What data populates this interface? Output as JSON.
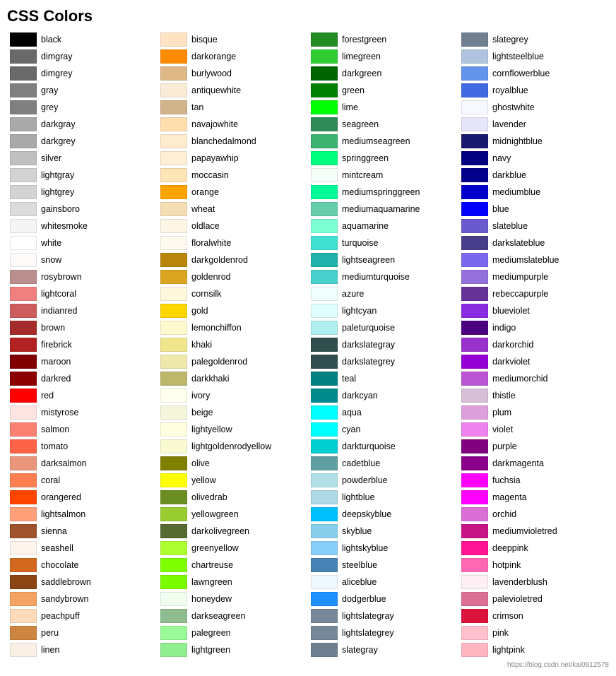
{
  "title": "CSS Colors",
  "colors": [
    {
      "name": "black",
      "hex": "#000000"
    },
    {
      "name": "dimgray",
      "hex": "#696969"
    },
    {
      "name": "dimgrey",
      "hex": "#696969"
    },
    {
      "name": "gray",
      "hex": "#808080"
    },
    {
      "name": "grey",
      "hex": "#808080"
    },
    {
      "name": "darkgray",
      "hex": "#a9a9a9"
    },
    {
      "name": "darkgrey",
      "hex": "#a9a9a9"
    },
    {
      "name": "silver",
      "hex": "#c0c0c0"
    },
    {
      "name": "lightgray",
      "hex": "#d3d3d3"
    },
    {
      "name": "lightgrey",
      "hex": "#d3d3d3"
    },
    {
      "name": "gainsboro",
      "hex": "#dcdcdc"
    },
    {
      "name": "whitesmoke",
      "hex": "#f5f5f5"
    },
    {
      "name": "white",
      "hex": "#ffffff"
    },
    {
      "name": "snow",
      "hex": "#fffafa"
    },
    {
      "name": "rosybrown",
      "hex": "#bc8f8f"
    },
    {
      "name": "lightcoral",
      "hex": "#f08080"
    },
    {
      "name": "indianred",
      "hex": "#cd5c5c"
    },
    {
      "name": "brown",
      "hex": "#a52a2a"
    },
    {
      "name": "firebrick",
      "hex": "#b22222"
    },
    {
      "name": "maroon",
      "hex": "#800000"
    },
    {
      "name": "darkred",
      "hex": "#8b0000"
    },
    {
      "name": "red",
      "hex": "#ff0000"
    },
    {
      "name": "mistyrose",
      "hex": "#ffe4e1"
    },
    {
      "name": "salmon",
      "hex": "#fa8072"
    },
    {
      "name": "tomato",
      "hex": "#ff6347"
    },
    {
      "name": "darksalmon",
      "hex": "#e9967a"
    },
    {
      "name": "coral",
      "hex": "#ff7f50"
    },
    {
      "name": "orangered",
      "hex": "#ff4500"
    },
    {
      "name": "lightsalmon",
      "hex": "#ffa07a"
    },
    {
      "name": "sienna",
      "hex": "#a0522d"
    },
    {
      "name": "seashell",
      "hex": "#fff5ee"
    },
    {
      "name": "chocolate",
      "hex": "#d2691e"
    },
    {
      "name": "saddlebrown",
      "hex": "#8b4513"
    },
    {
      "name": "sandybrown",
      "hex": "#f4a460"
    },
    {
      "name": "peachpuff",
      "hex": "#ffdab9"
    },
    {
      "name": "peru",
      "hex": "#cd853f"
    },
    {
      "name": "linen",
      "hex": "#faf0e6"
    },
    {
      "name": "bisque",
      "hex": "#ffe4c4"
    },
    {
      "name": "darkorange",
      "hex": "#ff8c00"
    },
    {
      "name": "burlywood",
      "hex": "#deb887"
    },
    {
      "name": "antiquewhite",
      "hex": "#faebd7"
    },
    {
      "name": "tan",
      "hex": "#d2b48c"
    },
    {
      "name": "navajowhite",
      "hex": "#ffdead"
    },
    {
      "name": "blanchedalmond",
      "hex": "#ffebcd"
    },
    {
      "name": "papayawhip",
      "hex": "#ffefd5"
    },
    {
      "name": "moccasin",
      "hex": "#ffe4b5"
    },
    {
      "name": "orange",
      "hex": "#ffa500"
    },
    {
      "name": "wheat",
      "hex": "#f5deb3"
    },
    {
      "name": "oldlace",
      "hex": "#fdf5e6"
    },
    {
      "name": "floralwhite",
      "hex": "#fffaf0"
    },
    {
      "name": "darkgoldenrod",
      "hex": "#b8860b"
    },
    {
      "name": "goldenrod",
      "hex": "#daa520"
    },
    {
      "name": "cornsilk",
      "hex": "#fff8dc"
    },
    {
      "name": "gold",
      "hex": "#ffd700"
    },
    {
      "name": "lemonchiffon",
      "hex": "#fffacd"
    },
    {
      "name": "khaki",
      "hex": "#f0e68c"
    },
    {
      "name": "palegoldenrod",
      "hex": "#eee8aa"
    },
    {
      "name": "darkkhaki",
      "hex": "#bdb76b"
    },
    {
      "name": "ivory",
      "hex": "#fffff0"
    },
    {
      "name": "beige",
      "hex": "#f5f5dc"
    },
    {
      "name": "lightyellow",
      "hex": "#ffffe0"
    },
    {
      "name": "lightgoldenrodyellow",
      "hex": "#fafad2"
    },
    {
      "name": "olive",
      "hex": "#808000"
    },
    {
      "name": "yellow",
      "hex": "#ffff00"
    },
    {
      "name": "olivedrab",
      "hex": "#6b8e23"
    },
    {
      "name": "yellowgreen",
      "hex": "#9acd32"
    },
    {
      "name": "darkolivegreen",
      "hex": "#556b2f"
    },
    {
      "name": "greenyellow",
      "hex": "#adff2f"
    },
    {
      "name": "chartreuse",
      "hex": "#7fff00"
    },
    {
      "name": "lawngreen",
      "hex": "#7cfc00"
    },
    {
      "name": "honeydew",
      "hex": "#f0fff0"
    },
    {
      "name": "darkseagreen",
      "hex": "#8fbc8f"
    },
    {
      "name": "palegreen",
      "hex": "#98fb98"
    },
    {
      "name": "lightgreen",
      "hex": "#90ee90"
    },
    {
      "name": "forestgreen",
      "hex": "#228b22"
    },
    {
      "name": "limegreen",
      "hex": "#32cd32"
    },
    {
      "name": "darkgreen",
      "hex": "#006400"
    },
    {
      "name": "green",
      "hex": "#008000"
    },
    {
      "name": "lime",
      "hex": "#00ff00"
    },
    {
      "name": "seagreen",
      "hex": "#2e8b57"
    },
    {
      "name": "mediumseagreen",
      "hex": "#3cb371"
    },
    {
      "name": "springgreen",
      "hex": "#00ff7f"
    },
    {
      "name": "mintcream",
      "hex": "#f5fffa"
    },
    {
      "name": "mediumspringgreen",
      "hex": "#00fa9a"
    },
    {
      "name": "mediumaquamarine",
      "hex": "#66cdaa"
    },
    {
      "name": "aquamarine",
      "hex": "#7fffd4"
    },
    {
      "name": "turquoise",
      "hex": "#40e0d0"
    },
    {
      "name": "lightseagreen",
      "hex": "#20b2aa"
    },
    {
      "name": "mediumturquoise",
      "hex": "#48d1cc"
    },
    {
      "name": "azure",
      "hex": "#f0ffff"
    },
    {
      "name": "lightcyan",
      "hex": "#e0ffff"
    },
    {
      "name": "paleturquoise",
      "hex": "#afeeee"
    },
    {
      "name": "darkslategray",
      "hex": "#2f4f4f"
    },
    {
      "name": "darkslategrey",
      "hex": "#2f4f4f"
    },
    {
      "name": "teal",
      "hex": "#008080"
    },
    {
      "name": "darkcyan",
      "hex": "#008b8b"
    },
    {
      "name": "aqua",
      "hex": "#00ffff"
    },
    {
      "name": "cyan",
      "hex": "#00ffff"
    },
    {
      "name": "darkturquoise",
      "hex": "#00ced1"
    },
    {
      "name": "cadetblue",
      "hex": "#5f9ea0"
    },
    {
      "name": "powderblue",
      "hex": "#b0e0e6"
    },
    {
      "name": "lightblue",
      "hex": "#add8e6"
    },
    {
      "name": "deepskyblue",
      "hex": "#00bfff"
    },
    {
      "name": "skyblue",
      "hex": "#87ceeb"
    },
    {
      "name": "lightskyblue",
      "hex": "#87cefa"
    },
    {
      "name": "steelblue",
      "hex": "#4682b4"
    },
    {
      "name": "aliceblue",
      "hex": "#f0f8ff"
    },
    {
      "name": "dodgerblue",
      "hex": "#1e90ff"
    },
    {
      "name": "lightslategray",
      "hex": "#778899"
    },
    {
      "name": "lightslategrey",
      "hex": "#778899"
    },
    {
      "name": "slategray",
      "hex": "#708090"
    },
    {
      "name": "slategrey",
      "hex": "#708090"
    },
    {
      "name": "lightsteelblue",
      "hex": "#b0c4de"
    },
    {
      "name": "cornflowerblue",
      "hex": "#6495ed"
    },
    {
      "name": "royalblue",
      "hex": "#4169e1"
    },
    {
      "name": "ghostwhite",
      "hex": "#f8f8ff"
    },
    {
      "name": "lavender",
      "hex": "#e6e6fa"
    },
    {
      "name": "midnightblue",
      "hex": "#191970"
    },
    {
      "name": "navy",
      "hex": "#000080"
    },
    {
      "name": "darkblue",
      "hex": "#00008b"
    },
    {
      "name": "mediumblue",
      "hex": "#0000cd"
    },
    {
      "name": "blue",
      "hex": "#0000ff"
    },
    {
      "name": "slateblue",
      "hex": "#6a5acd"
    },
    {
      "name": "darkslateblue",
      "hex": "#483d8b"
    },
    {
      "name": "mediumslateblue",
      "hex": "#7b68ee"
    },
    {
      "name": "mediumpurple",
      "hex": "#9370db"
    },
    {
      "name": "rebeccapurple",
      "hex": "#663399"
    },
    {
      "name": "blueviolet",
      "hex": "#8a2be2"
    },
    {
      "name": "indigo",
      "hex": "#4b0082"
    },
    {
      "name": "darkorchid",
      "hex": "#9932cc"
    },
    {
      "name": "darkviolet",
      "hex": "#9400d3"
    },
    {
      "name": "mediumorchid",
      "hex": "#ba55d3"
    },
    {
      "name": "thistle",
      "hex": "#d8bfd8"
    },
    {
      "name": "plum",
      "hex": "#dda0dd"
    },
    {
      "name": "violet",
      "hex": "#ee82ee"
    },
    {
      "name": "purple",
      "hex": "#800080"
    },
    {
      "name": "darkmagenta",
      "hex": "#8b008b"
    },
    {
      "name": "fuchsia",
      "hex": "#ff00ff"
    },
    {
      "name": "magenta",
      "hex": "#ff00ff"
    },
    {
      "name": "orchid",
      "hex": "#da70d6"
    },
    {
      "name": "mediumvioletred",
      "hex": "#c71585"
    },
    {
      "name": "deeppink",
      "hex": "#ff1493"
    },
    {
      "name": "hotpink",
      "hex": "#ff69b4"
    },
    {
      "name": "lavenderblush",
      "hex": "#fff0f5"
    },
    {
      "name": "palevioletred",
      "hex": "#db7093"
    },
    {
      "name": "crimson",
      "hex": "#dc143c"
    },
    {
      "name": "pink",
      "hex": "#ffc0cb"
    },
    {
      "name": "lightpink",
      "hex": "#ffb6c1"
    }
  ],
  "footer": "https://blog.csdn.net/kai0912578"
}
